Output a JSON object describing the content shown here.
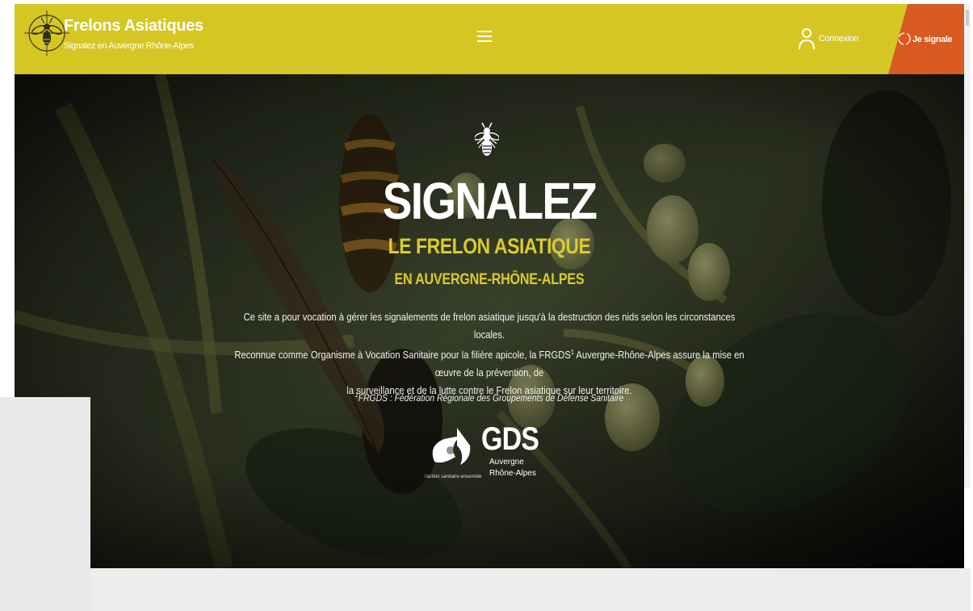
{
  "header": {
    "brand_title": "Frelons Asiatiques",
    "brand_subtitle": "Signalez en Auvergne Rhône-Alpes",
    "logo_icon": "hornet-target-icon",
    "menu_icon": "hamburger-menu-icon",
    "login_label": "Connexion",
    "login_icon": "user-icon",
    "report_label": "Je signale",
    "report_icon": "target-icon"
  },
  "hero": {
    "headline": "SIGNALEZ",
    "line2": "LE FRELON ASIATIQUE",
    "line3": "EN AUVERGNE-RHÔNE-ALPES",
    "desc_line1": "Ce site a pour vocation à gérer les signalements de frelon asiatique jusqu'à la destruction des nids selon les circonstances locales.",
    "desc_line2a": "Reconnue comme Organisme à Vocation Sanitaire pour la filière apicole, la FRGDS",
    "desc_sup": "1",
    "desc_line2b": " Auvergne-Rhône-Alpes assure la mise en œuvre de la prévention, de",
    "desc_line3": "la surveillance et de la lutte contre le Frelon asiatique sur leur territoire.",
    "foot_sup": "1",
    "foot": "FRGDS : Fédération Régionale des Groupements de Défense Sanitaire",
    "gds_logo": {
      "name": "GDS",
      "region_line1": "Auvergne",
      "region_line2": "Rhône-Alpes",
      "tagline": "l'action sanitaire ensemble"
    }
  },
  "colors": {
    "header_yellow": "#d6c624",
    "accent_orange": "#d85a20",
    "title_yellow": "#d9cb2e"
  }
}
